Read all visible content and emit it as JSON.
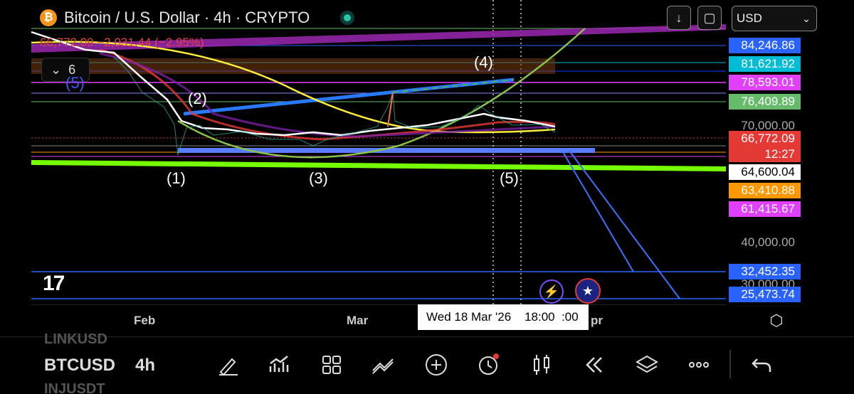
{
  "header": {
    "title": "Bitcoin / U.S. Dollar · 4h · CRYPTO",
    "logo_icon": "bitcoin-icon",
    "live_indicator": "live-dot",
    "price_change": "66,772.09  −2,031.44 (−2.95%)"
  },
  "top_buttons": {
    "download_icon": "↓",
    "fullscreen_icon": "▢",
    "currency": "USD"
  },
  "indicators_toggle": {
    "count": "6"
  },
  "price_labels": [
    {
      "text": "84,246.86",
      "bg": "#2962ff"
    },
    {
      "text": "81,621.92",
      "bg": "#00bcd4"
    },
    {
      "text": "78,593.01",
      "bg": "#e040fb"
    },
    {
      "text": "76,409.89",
      "bg": "#66bb6a"
    },
    {
      "text": "66,772.09",
      "bg": "#e53935"
    },
    {
      "text": "12:27",
      "bg": "#e53935"
    },
    {
      "text": "64,600.04",
      "bg": "#ffffff"
    },
    {
      "text": "63,410.88",
      "bg": "#ff9800"
    },
    {
      "text": "61,415.67",
      "bg": "#e040fb"
    },
    {
      "text": "32,452.35",
      "bg": "#2962ff"
    },
    {
      "text": "25,473.74",
      "bg": "#2962ff"
    }
  ],
  "price_ticks": [
    "70,000.00",
    "40,000.00",
    "30,000.00"
  ],
  "wave_labels": [
    "(1)",
    "(2)",
    "(3)",
    "(4)",
    "(5)",
    "(5)"
  ],
  "x_axis": {
    "labels": [
      "Feb",
      "Mar",
      "pr"
    ],
    "crosshair_date": "Wed 18 Mar '26",
    "crosshair_time": "18:00",
    "crosshair_suffix": ":00"
  },
  "bottom_bar": {
    "symbol": "BTCUSD",
    "interval": "4h",
    "ghost_above": "LINKUSD",
    "ghost_below": "INJUSDT",
    "tools": [
      "drawing-pen-icon",
      "indicators-icon",
      "layout-grid-icon",
      "trend-line-icon",
      "add-icon",
      "alert-clock-icon",
      "candlestick-icon",
      "replay-icon",
      "layers-icon",
      "more-icon",
      "undo-icon"
    ]
  },
  "colors": {
    "background": "#000000",
    "green_line": "#76ff03",
    "blue_line": "#2962ff",
    "magenta_band": "#9c27b0",
    "yellow_ma": "#ffeb3b",
    "white_ma": "#ffffff"
  }
}
